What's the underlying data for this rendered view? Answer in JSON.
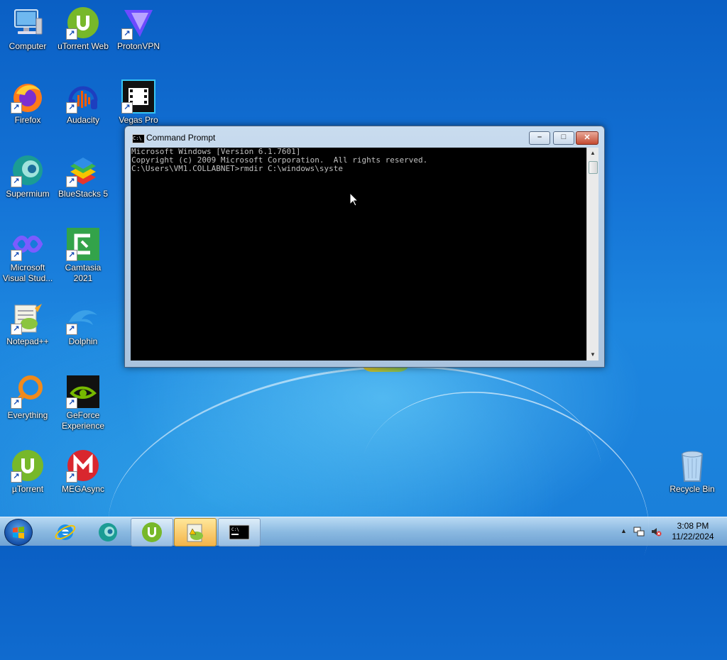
{
  "desktop": {
    "icons": [
      {
        "label": "Computer"
      },
      {
        "label": "uTorrent Web"
      },
      {
        "label": "ProtonVPN"
      },
      {
        "label": "Firefox"
      },
      {
        "label": "Audacity"
      },
      {
        "label": "Vegas Pro 13..."
      },
      {
        "label": "Supermium"
      },
      {
        "label": "BlueStacks 5"
      },
      {
        "label": "Microsoft Visual Stud..."
      },
      {
        "label": "Camtasia 2021"
      },
      {
        "label": "Notepad++"
      },
      {
        "label": "Dolphin"
      },
      {
        "label": "Everything"
      },
      {
        "label": "GeForce Experience"
      },
      {
        "label": "µTorrent"
      },
      {
        "label": "MEGAsync"
      },
      {
        "label": "Recycle Bin"
      }
    ]
  },
  "cmd_window": {
    "title": "Command Prompt",
    "lines": [
      "Microsoft Windows [Version 6.1.7601]",
      "Copyright (c) 2009 Microsoft Corporation.  All rights reserved.",
      "",
      "C:\\Users\\VM1.COLLABNET>rmdir C:\\windows\\syste"
    ],
    "buttons": {
      "minimize": "–",
      "maximize": "□",
      "close": "✕"
    }
  },
  "taskbar": {
    "items": [
      "Internet Explorer",
      "Supermium",
      "µTorrent",
      "Notepad++",
      "Command Prompt"
    ],
    "tray": {
      "time": "3:08 PM",
      "date": "11/22/2024",
      "show_hidden_icon": "▲"
    }
  },
  "colors": {
    "console_bg": "#000000",
    "console_text": "#c0c0c0",
    "desktop_blue": "#1473d6"
  }
}
